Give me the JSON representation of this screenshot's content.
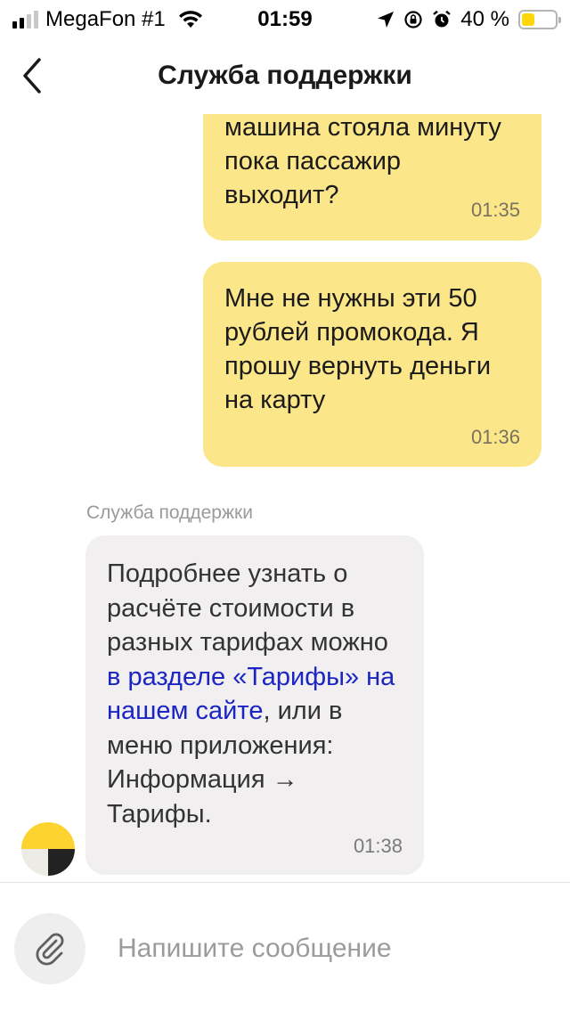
{
  "status_bar": {
    "carrier": "MegaFon #1",
    "time": "01:59",
    "battery_text": "40 %",
    "battery_level": 0.4
  },
  "header": {
    "title": "Служба поддержки",
    "back_icon": "chevron-left-icon"
  },
  "messages": [
    {
      "direction": "out",
      "lines": [
        "машина стояла минуту",
        "пока пассажир",
        "выходит?"
      ],
      "time": "01:35"
    },
    {
      "direction": "out",
      "lines": [
        "Мне не нужны эти 50",
        "рублей промокода. Я",
        "прошу вернуть деньги",
        "на карту"
      ],
      "time": "01:36"
    },
    {
      "direction": "in",
      "sender": "Служба поддержки",
      "text_before_link": "Подробнее узнать о расчёте стоимости в разных тарифах можно",
      "link_text": "в разделе «Тарифы» на нашем сайте",
      "text_after_link": ", или в меню приложения: Информация → Тарифы.",
      "time": "01:38"
    }
  ],
  "composer": {
    "placeholder": "Напишите сообщение",
    "attach_icon": "paperclip-icon"
  },
  "colors": {
    "outgoing_bubble": "#fce68a",
    "incoming_bubble": "#f1efef",
    "link": "#1a25c4",
    "accent_yellow": "#ffd60a"
  }
}
